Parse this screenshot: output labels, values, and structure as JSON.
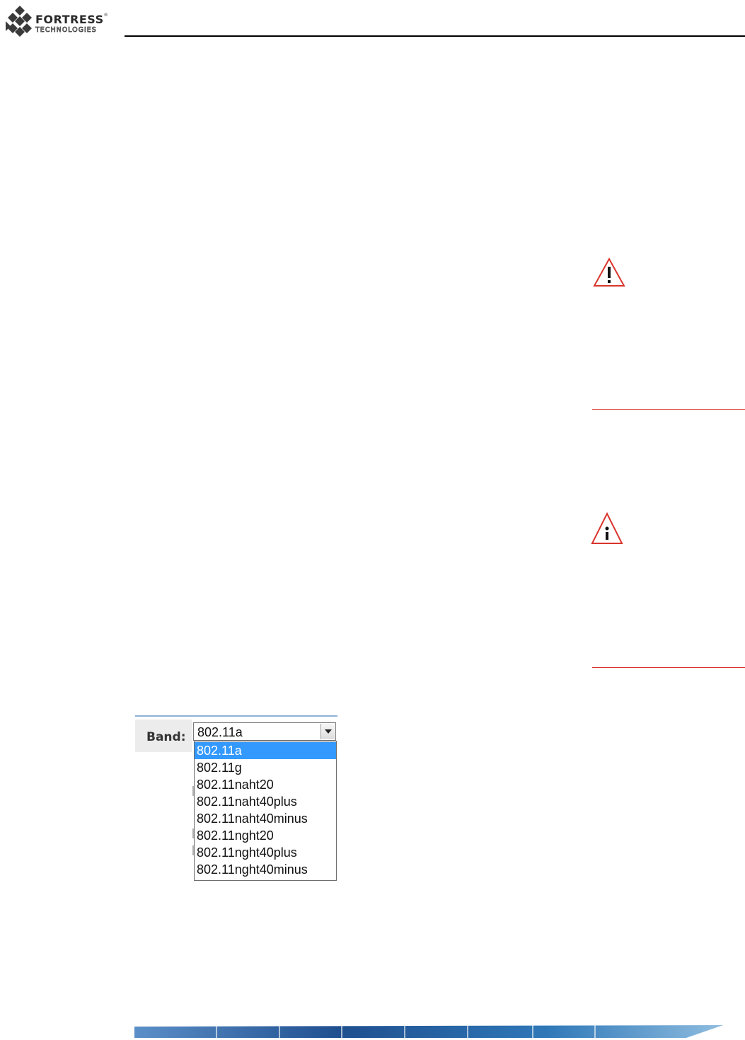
{
  "header": {
    "logo_word_main": "FORTRESS",
    "logo_registered": "®",
    "logo_word_sub": "TECHNOLOGIES",
    "logo_icon": "diamond-grid-icon"
  },
  "notices": [
    {
      "icon": "warning-triangle-icon",
      "color": "#d9352c"
    },
    {
      "icon": "info-triangle-icon",
      "color": "#d9352c"
    }
  ],
  "band_setting": {
    "label": "Band:",
    "selected_value": "802.11a",
    "options": [
      "802.11a",
      "802.11g",
      "802.11naht20",
      "802.11naht40plus",
      "802.11naht40minus",
      "802.11nght20",
      "802.11nght40plus",
      "802.11nght40minus"
    ],
    "highlighted_option_index": 0,
    "highlight_color": "#3399ff"
  },
  "footer": {
    "banner_colors": [
      "#5b8fc8",
      "#1f4f8f",
      "#2f78b8",
      "#8fbde0"
    ]
  }
}
